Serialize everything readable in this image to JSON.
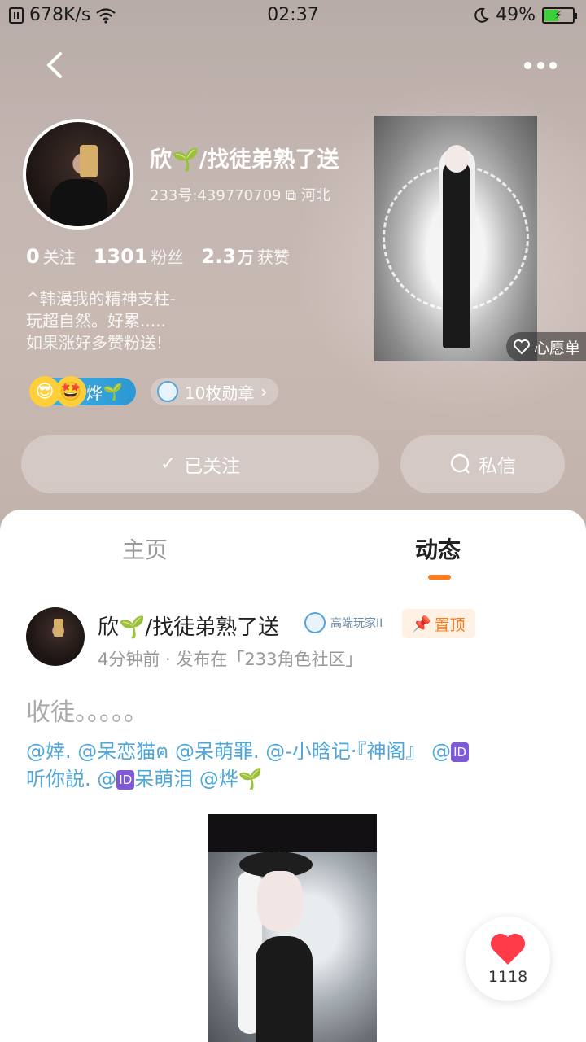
{
  "status_bar": {
    "net_speed": "678K/s",
    "time": "02:37",
    "battery": "49%",
    "battery_level": 0.49
  },
  "profile": {
    "name_prefix": "欣",
    "name_suffix": "/找徒弟熟了送",
    "uid": "233号:439770709",
    "location": "河北",
    "stats": [
      {
        "num": "0",
        "label": "关注"
      },
      {
        "num": "1301",
        "label": "粉丝"
      },
      {
        "num": "2.3",
        "unit": "万",
        "label": "获赞"
      }
    ],
    "bio": [
      "^韩漫我的精神支柱-",
      "玩超自然。好累.....",
      "如果涨好多赞粉送!"
    ],
    "friend_badge": "烨",
    "medals": "10枚勋章",
    "wishlist": "心愿单",
    "follow_button": "已关注",
    "message_button": "私信"
  },
  "tabs": {
    "home": "主页",
    "feed": "动态"
  },
  "post": {
    "author_prefix": "欣",
    "author_suffix": "/找徒弟熟了送",
    "level": "高端玩家II",
    "pinned": "置顶",
    "meta": "4分钟前 · 发布在「233角色社区」",
    "text": "收徒。。。。。",
    "mentions_line1_a": "@婞. @呆恋猫ฅ @呆萌罪. @-小晗记·『神阁』 @",
    "id_tag": "ID",
    "mentions_line2_a": "听你説. @",
    "mentions_line2_b": "呆萌泪 @烨"
  },
  "like": {
    "count": "1118"
  }
}
